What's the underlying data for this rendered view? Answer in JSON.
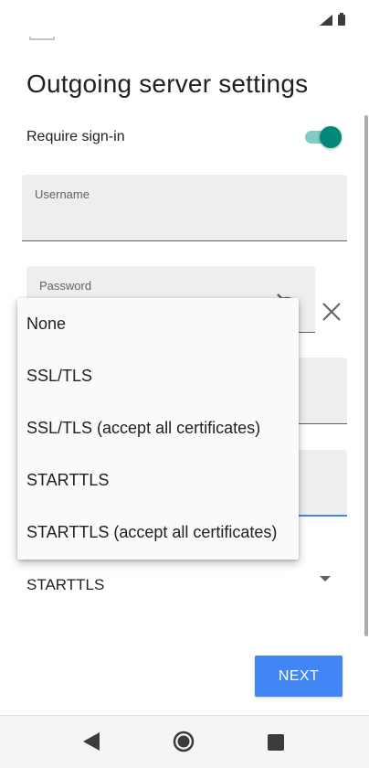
{
  "status_bar": {
    "icons": [
      "signal-icon",
      "battery-icon"
    ]
  },
  "page": {
    "title": "Outgoing server settings"
  },
  "require_signin": {
    "label": "Require sign-in",
    "enabled": true,
    "accent_color": "#00897b"
  },
  "fields": {
    "username_label": "Username",
    "password_label": "Password"
  },
  "security": {
    "selected": "STARTTLS",
    "options": [
      "None",
      "SSL/TLS",
      "SSL/TLS (accept all certificates)",
      "STARTTLS",
      "STARTTLS (accept all certificates)"
    ]
  },
  "actions": {
    "next_label": "NEXT",
    "next_color": "#4285f4"
  },
  "nav": {
    "icons": [
      "back-icon",
      "home-icon",
      "recents-icon"
    ]
  }
}
